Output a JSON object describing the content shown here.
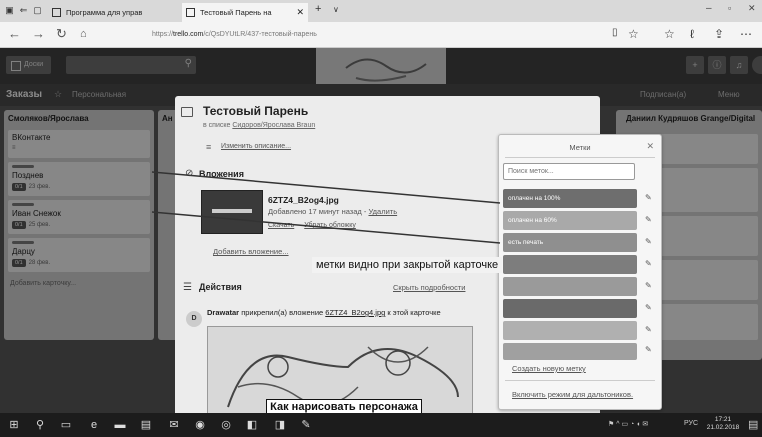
{
  "browser": {
    "tabs": [
      "Программа для управ",
      "Тестовый Парень на"
    ],
    "url_prefix": "https://",
    "url_domain": "trello.com",
    "url_path": "/c/QsDYUtLR/437-тестовый-парень"
  },
  "header": {
    "boards_label": "Доски"
  },
  "board": {
    "name": "Заказы",
    "visibility": "Персональная",
    "subscribed": "Подписан(а)",
    "menu": "Меню"
  },
  "lists": [
    {
      "title": "Смоляков/Ярослава",
      "cards": [
        {
          "title": "ВКонтакте"
        },
        {
          "title": "Позднев",
          "badge": "0/1",
          "date": "23 фев."
        },
        {
          "title": "Иван Снежок",
          "badge": "0/1",
          "date": "25 фев."
        },
        {
          "title": "Дарцу",
          "badge": "0/1",
          "date": "28 фев."
        }
      ],
      "add_card": "Добавить карточку..."
    },
    {
      "title": "Ан"
    },
    {
      "title": "Даниил Кудряшов Grange/Digital"
    }
  ],
  "card": {
    "title": "Тестовый Парень",
    "in_list": "в списке",
    "list_name": "Сидоров/Ярослава Braun",
    "edit_desc": "Изменить описание...",
    "attachments_heading": "Вложения",
    "attachment": {
      "name": "6ZTZ4_B2og4.jpg",
      "added": "Добавлено 17 минут назад -",
      "delete": "Удалить",
      "download": "Скачать",
      "remove_cover": "Убрать обложку"
    },
    "add_attachment": "Добавить вложение...",
    "activity_heading": "Действия",
    "hide_details": "Скрыть подробности",
    "activity": {
      "avatar": "D",
      "user": "Drawatar",
      "action": "прикрепил(а) вложение",
      "file": "6ZTZ4_B2og4.jpg",
      "suffix": "к этой карточке"
    },
    "preview_caption": "Как нарисовать персонажа"
  },
  "labels": {
    "title": "Метки",
    "search_placeholder": "Поиск меток...",
    "items": [
      "оплачен на 100%",
      "оплачен на 60%",
      "есть печать"
    ],
    "create": "Создать новую метку",
    "colorblind": "Включить режим для дальтоников."
  },
  "annotation": "метки видно при закрытой карточке",
  "taskbar": {
    "lang": "РУС",
    "time": "17:21",
    "date": "21.02.2018"
  }
}
